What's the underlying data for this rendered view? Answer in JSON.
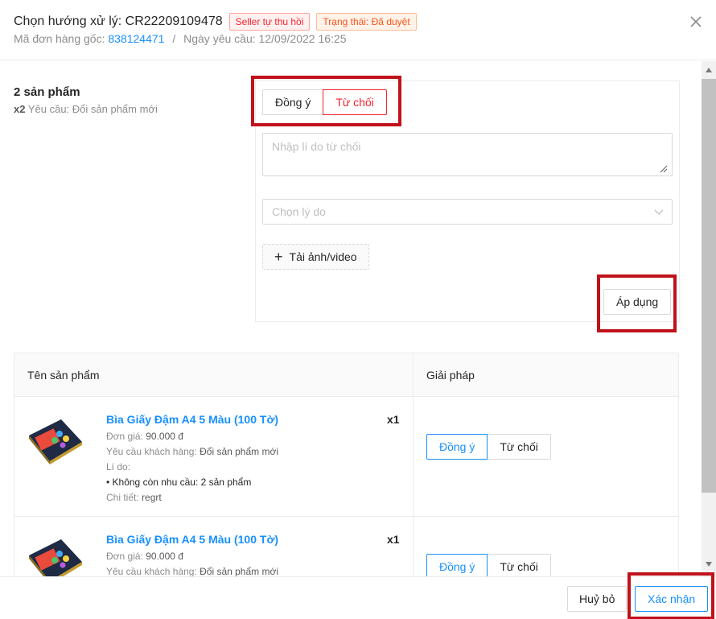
{
  "header": {
    "title": "Chọn hướng xử lý: CR22209109478",
    "badge_seller": "Seller tự thu hồi",
    "badge_status": "Trạng thái: Đã duyệt",
    "order_label": "Mã đơn hàng gốc:",
    "order_id": "838124471",
    "separator": "/",
    "request_date": "Ngày yêu cầu: 12/09/2022 16:25"
  },
  "summary": {
    "count": "2 sản phẩm",
    "qty": "x2",
    "request": "Yêu cầu: Đổi sản phẩm mới"
  },
  "decision": {
    "accept": "Đồng ý",
    "reject": "Từ chối",
    "selected": "reject",
    "reason_placeholder": "Nhập lí do từ chối",
    "select_placeholder": "Chọn lý do",
    "upload": "Tải ảnh/video",
    "apply": "Áp dụng"
  },
  "table": {
    "col_product": "Tên sản phẩm",
    "col_solution": "Giải pháp",
    "rows": [
      {
        "name": "Bìa Giấy Đậm A4 5 Màu (100 Tờ)",
        "qty": "x1",
        "price_label": "Đơn giá:",
        "price": "90.000 đ",
        "request_label": "Yêu cầu khách hàng:",
        "request": "Đổi sản phẩm mới",
        "reason_label": "Lí do:",
        "reason": "• Không còn nhu cầu: 2 sản phẩm",
        "detail_label": "Chi tiết:",
        "detail": "regrt",
        "accept": "Đồng ý",
        "reject": "Từ chối"
      },
      {
        "name": "Bìa Giấy Đậm A4 5 Màu (100 Tờ)",
        "qty": "x1",
        "price_label": "Đơn giá:",
        "price": "90.000 đ",
        "request_label": "Yêu cầu khách hàng:",
        "request": "Đổi sản phẩm mới",
        "accept": "Đồng ý",
        "reject": "Từ chối"
      }
    ]
  },
  "footer": {
    "cancel": "Huỷ bỏ",
    "confirm": "Xác nhận"
  },
  "colors": {
    "primary": "#1890ff",
    "danger": "#f5222d",
    "highlight": "#c0121b"
  }
}
